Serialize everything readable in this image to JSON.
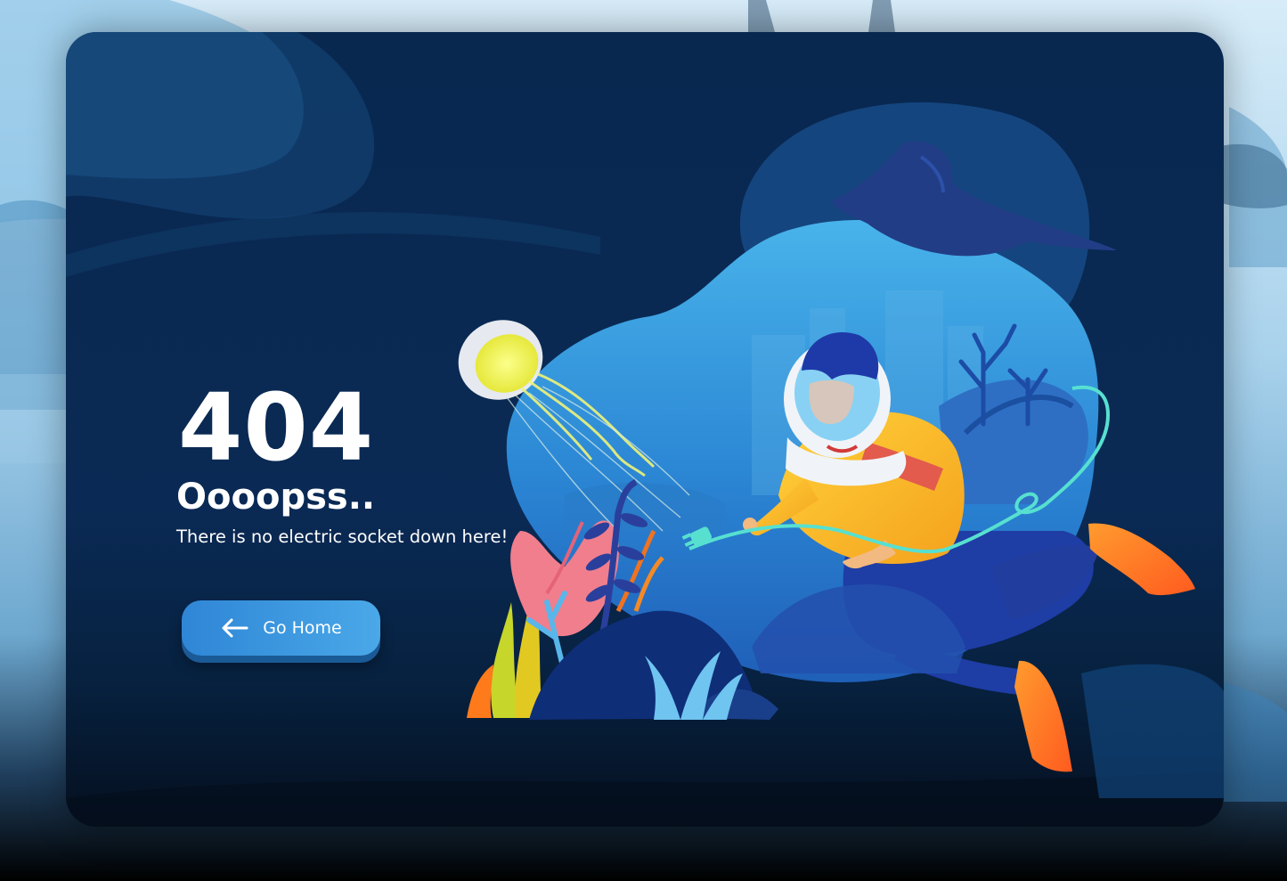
{
  "error": {
    "code": "404",
    "headline": "Oooopss..",
    "message": "There is no electric socket down here!"
  },
  "actions": {
    "home_label": "Go Home",
    "home_icon": "arrow-left-icon"
  },
  "illustration": {
    "subject": "diver-with-plug",
    "elements": [
      "jellyfish",
      "manta-ray",
      "diver",
      "electric-plug",
      "coral",
      "seaweed",
      "fins"
    ]
  },
  "colors": {
    "card_background": "#0a2a55",
    "button": "#3d9be0",
    "button_shadow": "#1a5a96",
    "text": "#ffffff"
  }
}
